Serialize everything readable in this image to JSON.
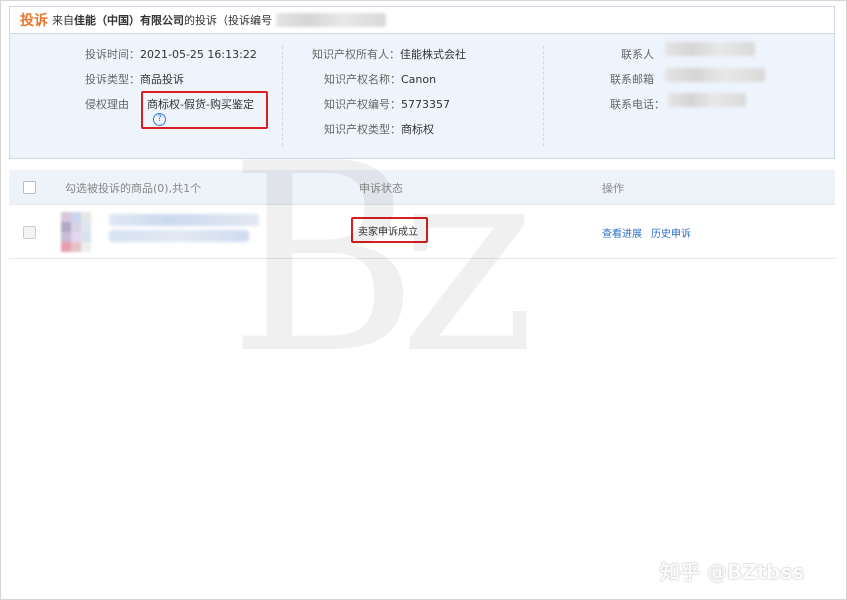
{
  "header": {
    "tag": "投诉",
    "from": "来自",
    "company": "佳能（中国）有限公司",
    "suffix": "的投诉（投诉编号"
  },
  "info": {
    "col1": {
      "time_label": "投诉时间：",
      "time_value": "2021-05-25 16:13:22",
      "type_label": "投诉类型：",
      "type_value": "商品投诉",
      "reason_label": "侵权理由",
      "reason_value": "商标权-假货-购买鉴定",
      "help_glyph": "?"
    },
    "col2": {
      "owner_label": "知识产权所有人：",
      "owner_value": "佳能株式会社",
      "name_label": "知识产权名称：",
      "name_value": "Canon",
      "number_label": "知识产权编号：",
      "number_value": "5773357",
      "ip_type_label": "知识产权类型：",
      "ip_type_value": "商标权"
    },
    "col3": {
      "contact_label": "联系人",
      "email_label": "联系邮箱",
      "phone_label": "联系电话："
    }
  },
  "table": {
    "headers": {
      "goods": "勾选被投诉的商品(0),共1个",
      "status": "申诉状态",
      "action": "操作"
    },
    "rows": [
      {
        "status": "卖家申诉成立",
        "action_progress": "查看进展",
        "action_history": "历史申诉"
      }
    ]
  },
  "watermark": {
    "text": "Bz",
    "credit": "知乎 @BZtbss"
  },
  "colors": {
    "accent_orange": "#e8772e",
    "link_blue": "#2a6fc9",
    "highlight_red": "#d81e1e",
    "panel_bg": "#eef4fb"
  },
  "icons": {
    "help": "question-circle-icon",
    "checkbox": "checkbox-icon"
  }
}
